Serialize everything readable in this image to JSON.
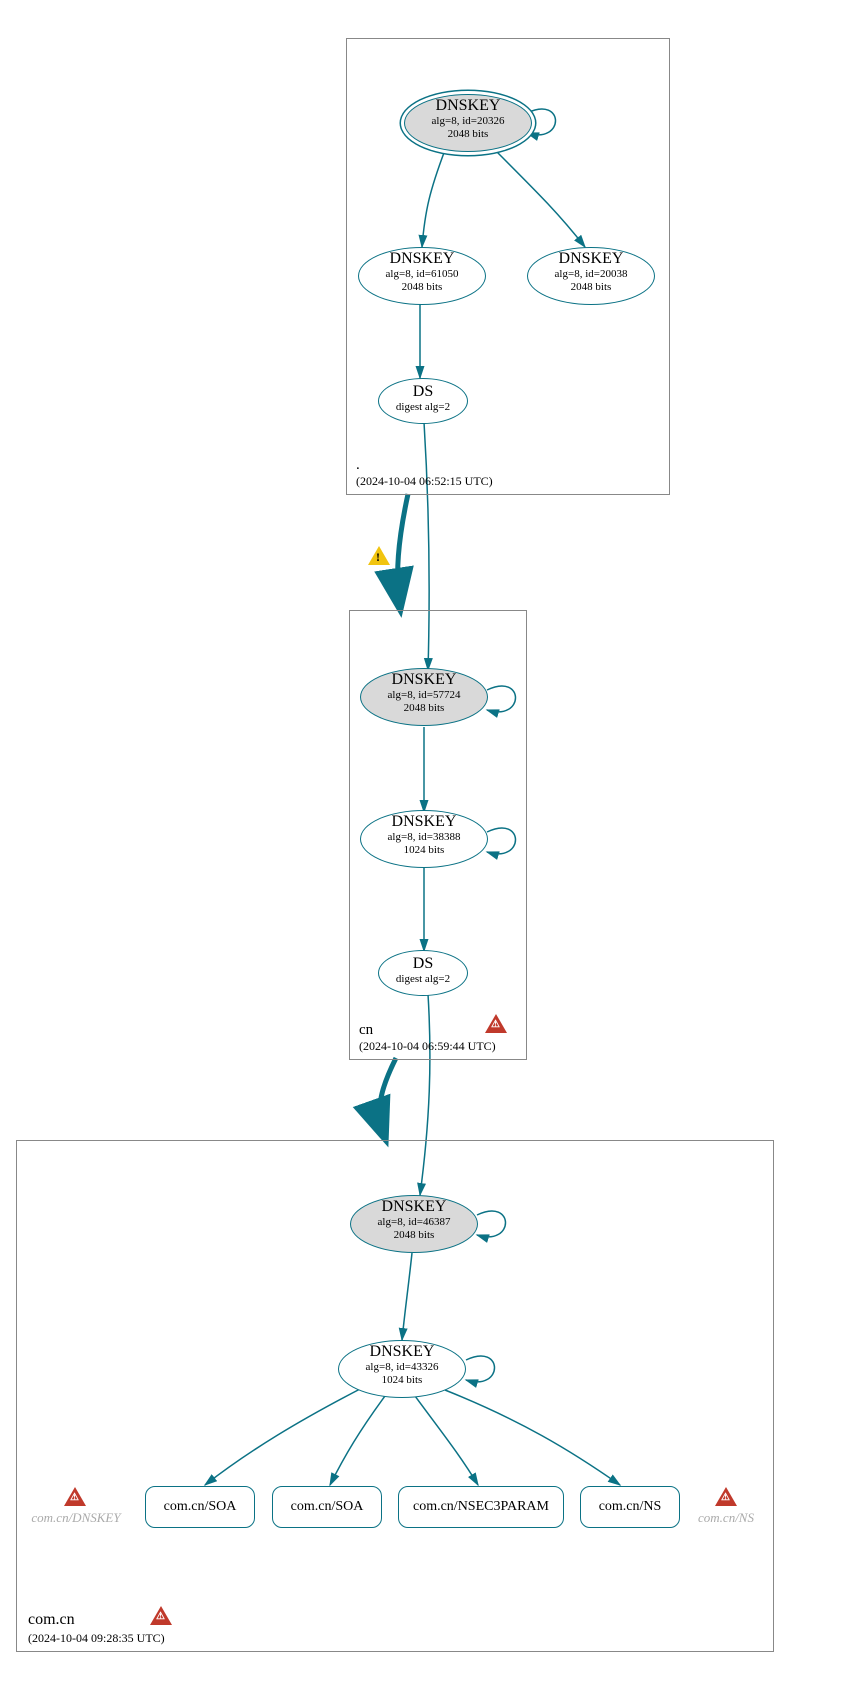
{
  "zones": {
    "root": {
      "name": ".",
      "timestamp": "(2024-10-04 06:52:15 UTC)"
    },
    "cn": {
      "name": "cn",
      "timestamp": "(2024-10-04 06:59:44 UTC)"
    },
    "comcn": {
      "name": "com.cn",
      "timestamp": "(2024-10-04 09:28:35 UTC)"
    }
  },
  "nodes": {
    "root_ksk": {
      "title": "DNSKEY",
      "line2": "alg=8, id=20326",
      "line3": "2048 bits"
    },
    "root_zsk1": {
      "title": "DNSKEY",
      "line2": "alg=8, id=61050",
      "line3": "2048 bits"
    },
    "root_zsk2": {
      "title": "DNSKEY",
      "line2": "alg=8, id=20038",
      "line3": "2048 bits"
    },
    "root_ds": {
      "title": "DS",
      "line2": "digest alg=2",
      "line3": ""
    },
    "cn_ksk": {
      "title": "DNSKEY",
      "line2": "alg=8, id=57724",
      "line3": "2048 bits"
    },
    "cn_zsk": {
      "title": "DNSKEY",
      "line2": "alg=8, id=38388",
      "line3": "1024 bits"
    },
    "cn_ds": {
      "title": "DS",
      "line2": "digest alg=2",
      "line3": ""
    },
    "comcn_ksk": {
      "title": "DNSKEY",
      "line2": "alg=8, id=46387",
      "line3": "2048 bits"
    },
    "comcn_zsk": {
      "title": "DNSKEY",
      "line2": "alg=8, id=43326",
      "line3": "1024 bits"
    }
  },
  "rrs": {
    "soa1": "com.cn/SOA",
    "soa2": "com.cn/SOA",
    "nsec3": "com.cn/NSEC3PARAM",
    "ns": "com.cn/NS"
  },
  "ghosts": {
    "dnskey": "com.cn/DNSKEY",
    "ns": "com.cn/NS"
  }
}
